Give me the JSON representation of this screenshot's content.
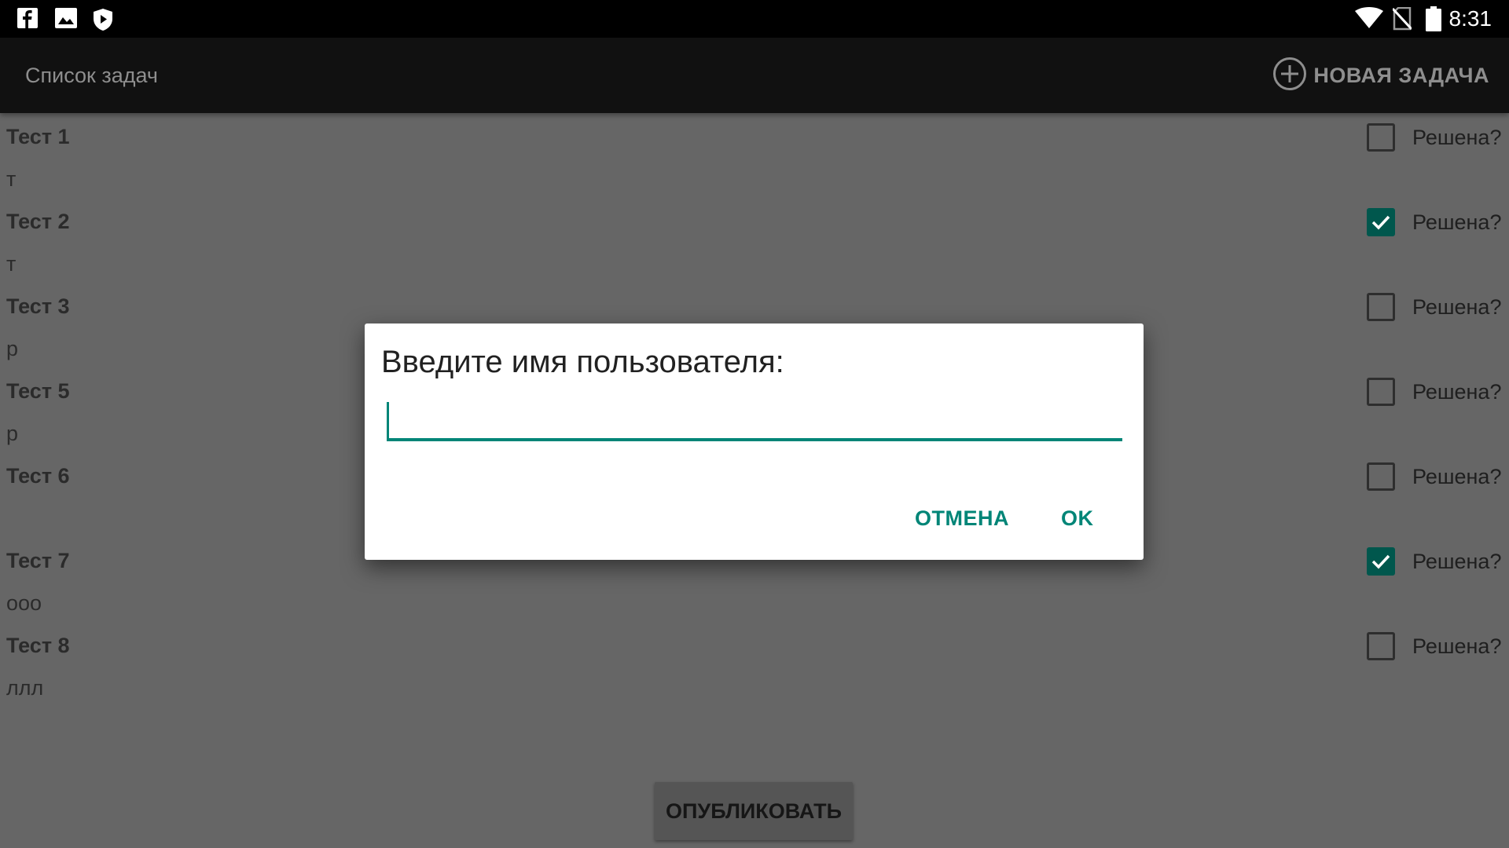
{
  "status_bar": {
    "time": "8:31",
    "left_icons": [
      "facebook-icon",
      "image-icon",
      "shield-play-icon"
    ],
    "right_icons": [
      "wifi-icon",
      "no-sim-icon",
      "battery-icon"
    ]
  },
  "app_bar": {
    "title": "Список задач",
    "new_task_label": "НОВАЯ ЗАДАЧА",
    "new_task_icon": "add-circle-icon"
  },
  "tasks": [
    {
      "title": "Тест 1",
      "description": "т",
      "checked": false,
      "check_label": "Решена?"
    },
    {
      "title": "Тест 2",
      "description": "т",
      "checked": true,
      "check_label": "Решена?"
    },
    {
      "title": "Тест 3",
      "description": "р",
      "checked": false,
      "check_label": "Решена?"
    },
    {
      "title": "Тест 5",
      "description": "р",
      "checked": false,
      "check_label": "Решена?"
    },
    {
      "title": "Тест 6",
      "description": "",
      "checked": false,
      "check_label": "Решена?"
    },
    {
      "title": "Тест 7",
      "description": "ооо",
      "checked": true,
      "check_label": "Решена?"
    },
    {
      "title": "Тест 8",
      "description": "ллл",
      "checked": false,
      "check_label": "Решена?"
    }
  ],
  "publish_button": {
    "label": "ОПУБЛИКОВАТЬ"
  },
  "dialog": {
    "title": "Введите имя пользователя:",
    "input_value": "",
    "cancel_label": "ОТМЕНА",
    "ok_label": "OK"
  },
  "colors": {
    "accent": "#008577",
    "checkbox_checked": "#00574d",
    "status_bar": "#000000",
    "app_bar": "#111111",
    "scrim_background": "#666666"
  }
}
